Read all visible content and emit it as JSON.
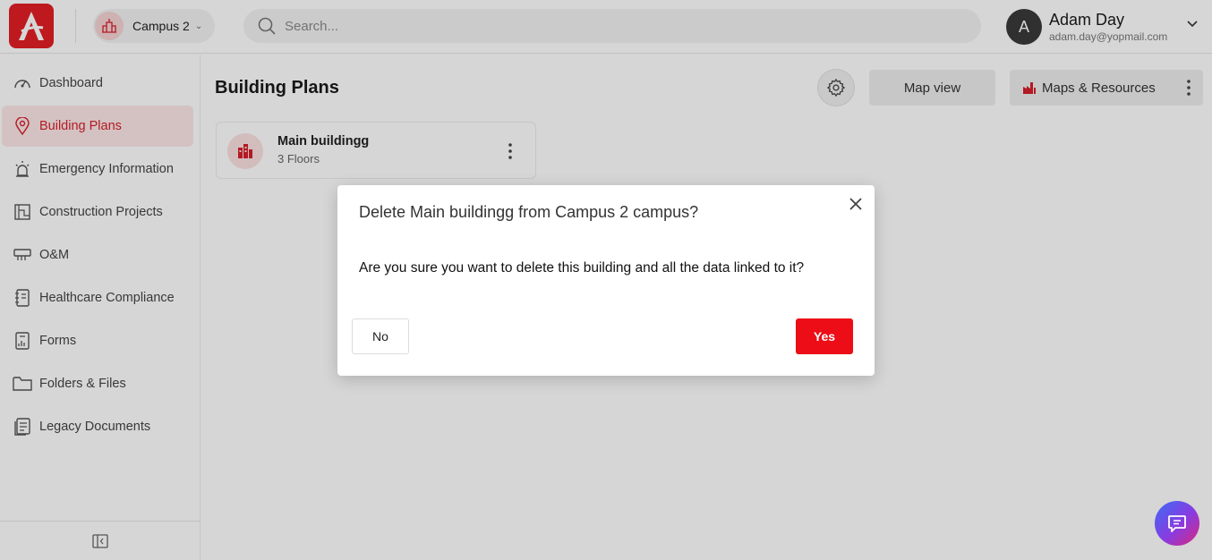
{
  "header": {
    "campus_label": "Campus 2",
    "search_placeholder": "Search...",
    "user": {
      "initial": "A",
      "name": "Adam Day",
      "email": "adam.day@yopmail.com"
    }
  },
  "sidebar": {
    "items": [
      {
        "label": "Dashboard",
        "icon": "gauge-icon"
      },
      {
        "label": "Building Plans",
        "icon": "map-pin-icon",
        "active": true
      },
      {
        "label": "Emergency Information",
        "icon": "siren-icon"
      },
      {
        "label": "Construction Projects",
        "icon": "blueprint-icon"
      },
      {
        "label": "O&M",
        "icon": "equipment-icon"
      },
      {
        "label": "Healthcare Compliance",
        "icon": "notebook-icon"
      },
      {
        "label": "Forms",
        "icon": "form-icon"
      },
      {
        "label": "Folders & Files",
        "icon": "folder-icon"
      },
      {
        "label": "Legacy Documents",
        "icon": "documents-icon"
      }
    ]
  },
  "main": {
    "title": "Building Plans",
    "map_view_label": "Map view",
    "maps_resources_label": "Maps & Resources",
    "building": {
      "name": "Main buildingg",
      "floors": "3 Floors"
    }
  },
  "modal": {
    "title": "Delete Main buildingg from Campus 2 campus?",
    "body": "Are you sure you want to delete this building and all the data linked to it?",
    "no_label": "No",
    "yes_label": "Yes"
  },
  "colors": {
    "brand": "#e31e24",
    "danger": "#ec0d16",
    "active_bg": "#fde8e8"
  }
}
